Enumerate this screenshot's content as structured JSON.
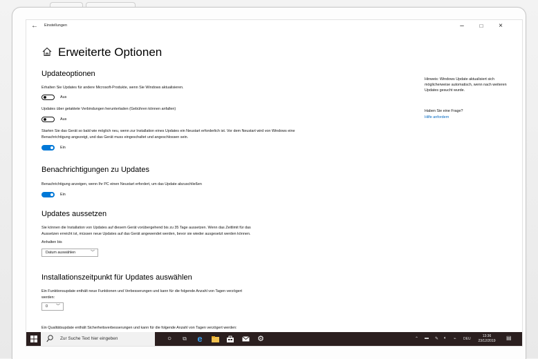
{
  "window": {
    "back_glyph": "←",
    "app_title": "Einstellungen",
    "minimize_glyph": "–",
    "maximize_glyph": "□",
    "close_glyph": "×"
  },
  "page": {
    "home_icon": "home-icon",
    "title": "Erweiterte Optionen"
  },
  "update_options": {
    "heading": "Updateoptionen",
    "other_products_text": "Erhalten Sie Updates für andere Microsoft-Produkte, wenn Sie Windows aktualisieren.",
    "other_products_state": "Aus",
    "metered_text": "Updates über getaktete Verbindungen herunterladen (Gebühren können anfallen)",
    "metered_state": "Aus",
    "restart_text_1": "Starten Sie das Gerät so bald wie möglich neu, wenn zur Installation eines Updates ein Neustart erforderlich ist. Vor dem Neustart wird von Windows eine",
    "restart_text_2": "Benachrichtigung angezeigt, und das Gerät muss eingeschaltet und angeschlossen sein.",
    "restart_state": "Ein"
  },
  "notifications": {
    "heading": "Benachrichtigungen zu Updates",
    "text": "Benachrichtigung anzeigen, wenn Ihr PC einen Neustart erfordert, um das Update abzuschließen",
    "state": "Ein"
  },
  "pause": {
    "heading": "Updates aussetzen",
    "text_1": "Sie können die Installation von Updates auf diesem Gerät vorübergehend bis zu 35 Tage aussetzen. Wenn das Zeitlimit für das",
    "text_2": "Aussetzen erreicht ist, müssen neue Updates auf das Gerät angewendet werden, bevor sie wieder ausgesetzt werden können.",
    "until_label": "Anhalten bis",
    "date_select": "Datum auswählen"
  },
  "install_time": {
    "heading": "Installationszeitpunkt für Updates auswählen",
    "feature_text_1": "Ein Funktionsupdate enthält neue Funktionen und Verbesserungen und kann für die folgende Anzahl von Tagen verzögert",
    "feature_text_2": "werden:",
    "feature_days": "0",
    "quality_text": "Ein Qualitätsupdate enthält Sicherheitsverbesserungen und kann für die folgende Anzahl von Tagen verzögert werden:"
  },
  "sidebar": {
    "hint": "Hinweis: Windows Update aktualisiert sich möglicherweise automatisch, wenn nach weiteren Updates gesucht wurde.",
    "question": "Haben Sie eine Frage?",
    "help_link": "Hilfe anfordern"
  },
  "taskbar": {
    "search_placeholder": "Zur Suche Text hier eingeben",
    "language": "DEU",
    "time": "13:36",
    "date": "23/12/2019",
    "icons": [
      "windows-start-icon",
      "search-icon",
      "cortana-icon",
      "task-view-icon",
      "edge-icon",
      "file-explorer-icon",
      "store-icon",
      "mail-icon",
      "settings-icon"
    ]
  },
  "colors": {
    "accent": "#0078d7",
    "link": "#0067c0",
    "taskbar": "#2b1f1f"
  }
}
